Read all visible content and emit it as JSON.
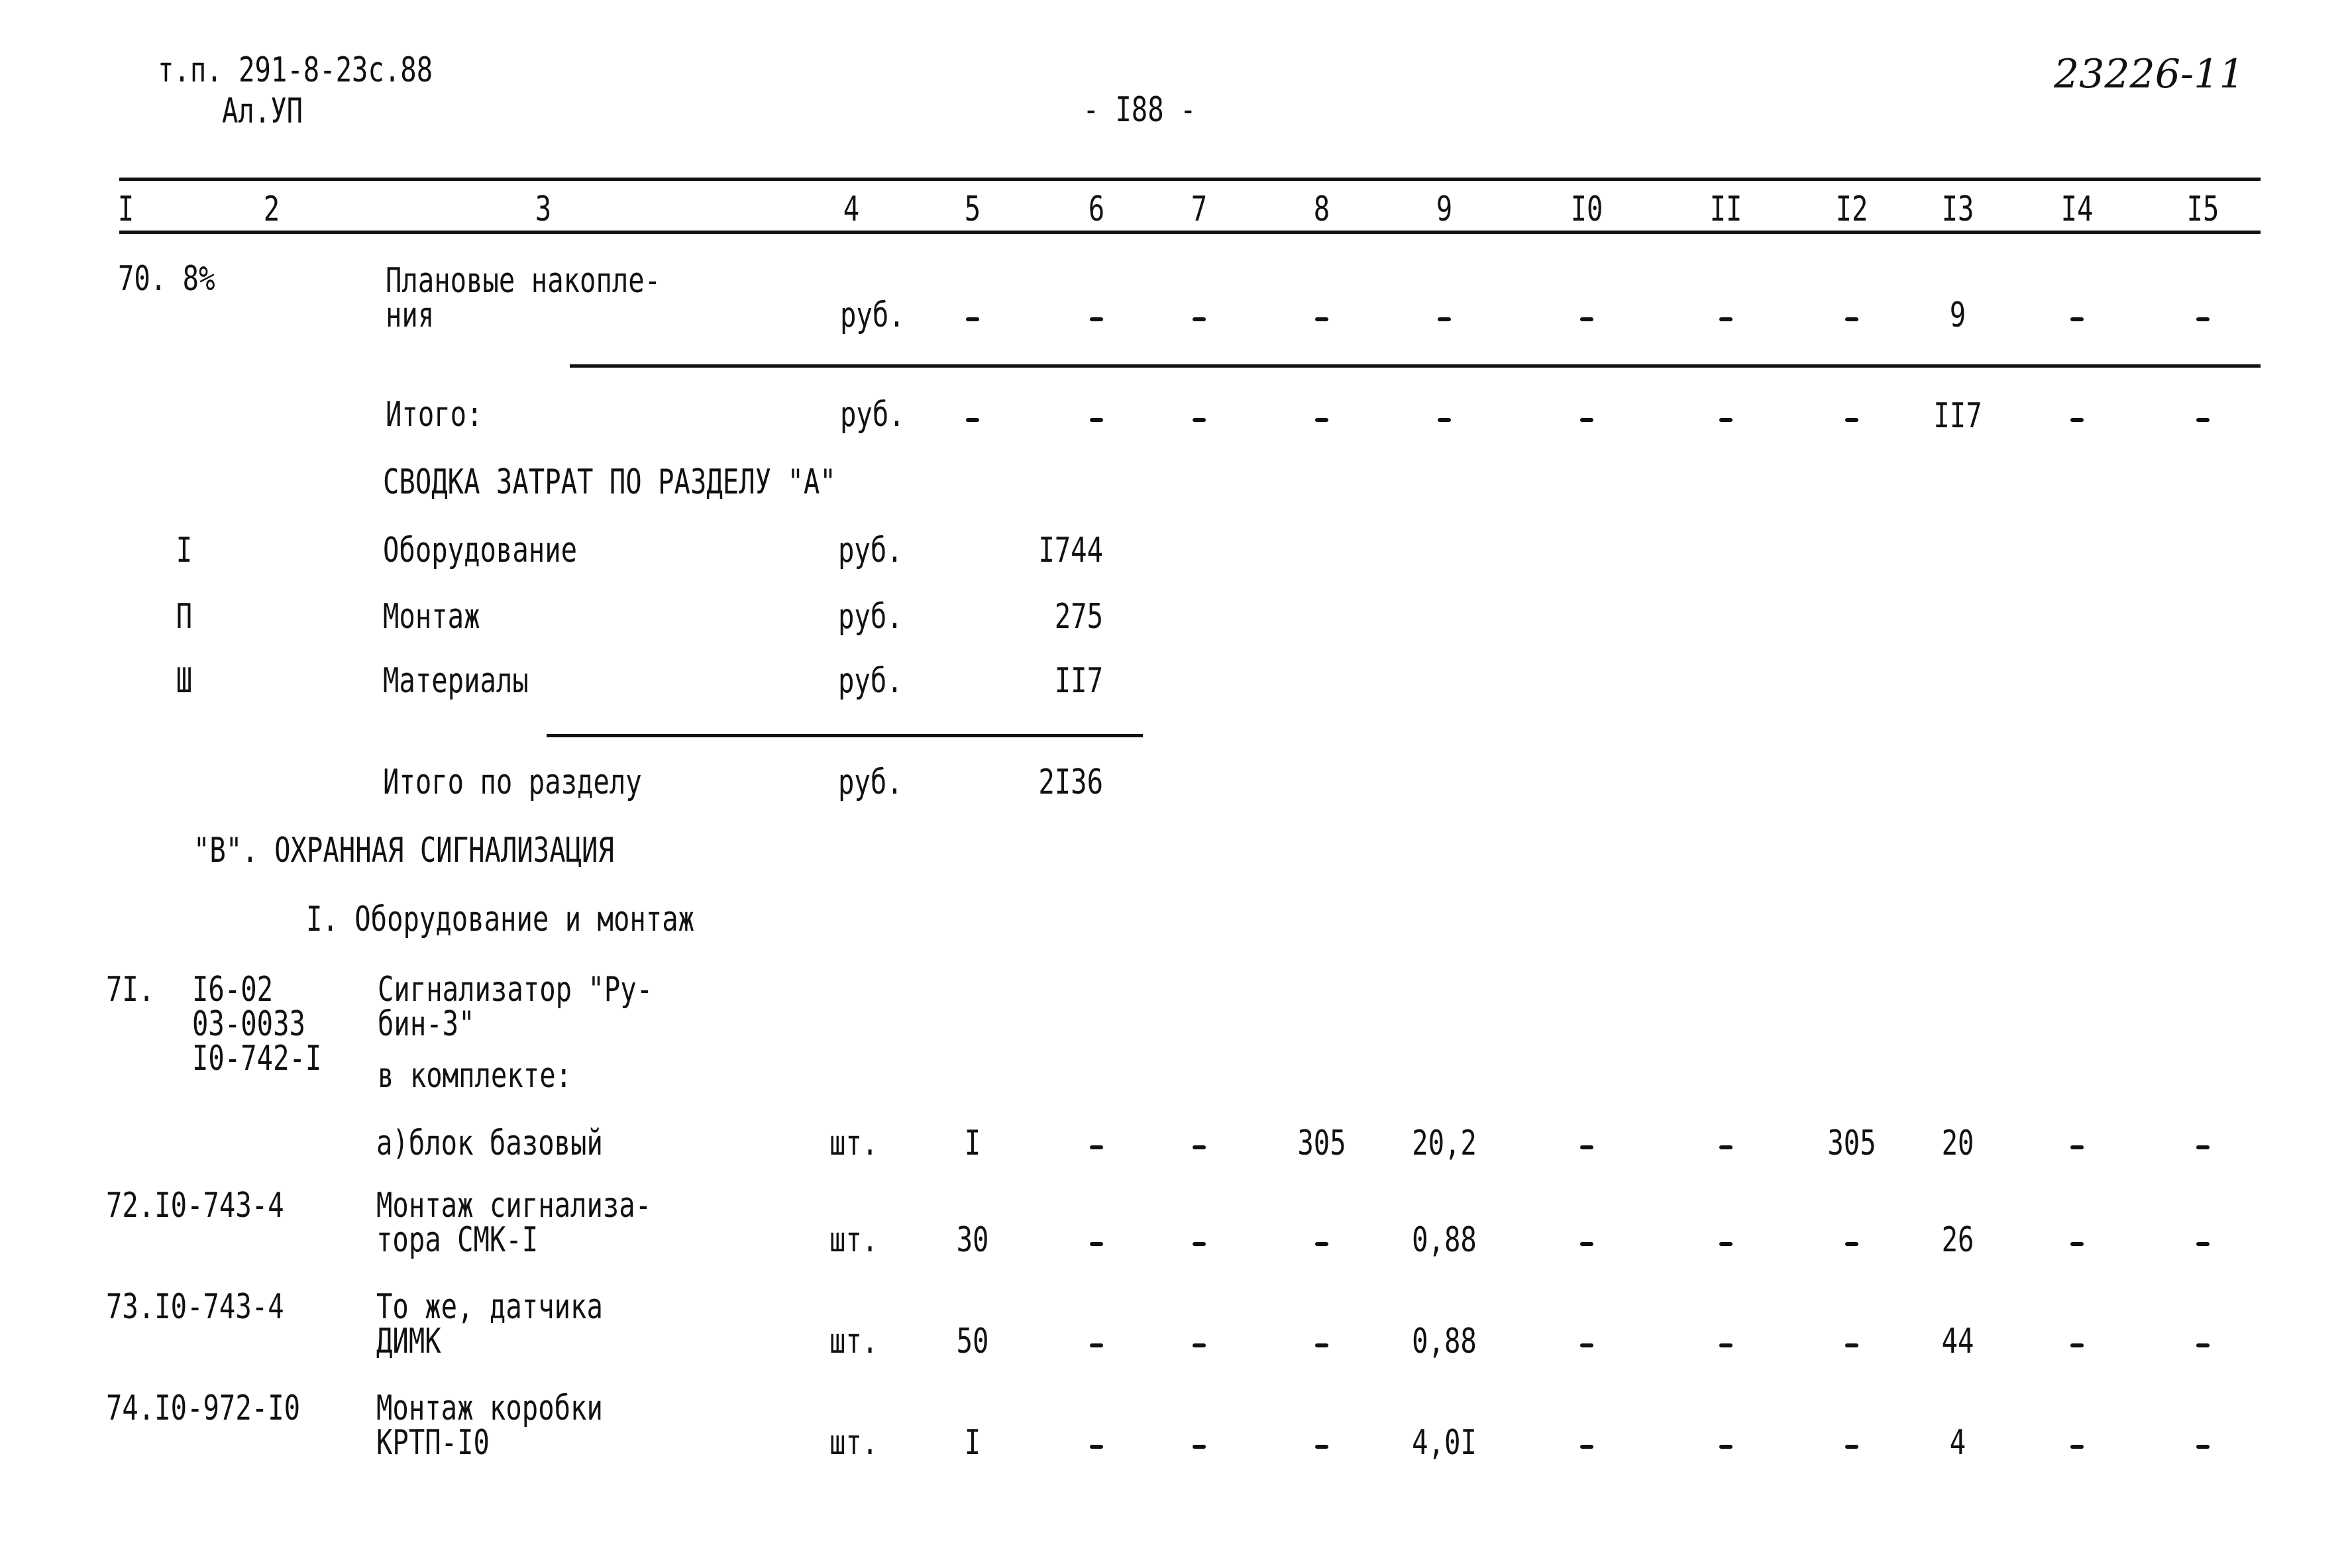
{
  "header": {
    "doc_ref": "т.п. 291-8-23с.88",
    "album": "Ал.УП",
    "page_number": "- I88 -",
    "inventory_number": "23226-11"
  },
  "columns": [
    "I",
    "2",
    "3",
    "4",
    "5",
    "6",
    "7",
    "8",
    "9",
    "I0",
    "II",
    "I2",
    "I3",
    "I4",
    "I5"
  ],
  "rows_top": [
    {
      "c1": "70. 8%",
      "c3a": "Плановые накопле-",
      "c3b": "ния",
      "c4": "руб.",
      "cells": [
        "-",
        "-",
        "-",
        "-",
        "-",
        "-",
        "-",
        "-",
        "9",
        "-",
        "-"
      ]
    },
    {
      "c3b": "Итого:",
      "c4": "руб.",
      "cells": [
        "-",
        "-",
        "-",
        "-",
        "-",
        "-",
        "-",
        "-",
        "II7",
        "-",
        "-"
      ]
    }
  ],
  "summary": {
    "title": "СВОДКА ЗАТРАТ ПО РАЗДЕЛУ \"А\"",
    "items": [
      {
        "num": "I",
        "label": "Оборудование",
        "unit": "руб.",
        "value": "I744"
      },
      {
        "num": "П",
        "label": "Монтаж",
        "unit": "руб.",
        "value": "275"
      },
      {
        "num": "Ш",
        "label": "Материалы",
        "unit": "руб.",
        "value": "II7"
      }
    ],
    "total": {
      "label": "Итого по разделу",
      "unit": "руб.",
      "value": "2I36"
    }
  },
  "section_b": {
    "title": "\"В\". ОХРАННАЯ СИГНАЛИЗАЦИЯ",
    "subtitle": "I. Оборудование и монтаж"
  },
  "item71": {
    "num": "7I.",
    "code1": "I6-02",
    "code2": "03-0033",
    "code3": "I0-742-I",
    "name1": "Сигнализатор \"Ру-",
    "name2": "бин-3\"",
    "name3": "в комплекте:"
  },
  "rows_bottom": [
    {
      "label1": "а)блок базовый",
      "label2": "",
      "code": "",
      "unit": "шт.",
      "qty": "I",
      "cells": [
        "-",
        "-",
        "305",
        "20,2",
        "-",
        "-",
        "305",
        "20",
        "-",
        "-"
      ]
    },
    {
      "code": "72.I0-743-4",
      "label1": "Монтаж сигнализа-",
      "label2": "тора СМК-I",
      "unit": "шт.",
      "qty": "30",
      "cells": [
        "-",
        "-",
        "-",
        "0,88",
        "-",
        "-",
        "-",
        "26",
        "-",
        "-"
      ]
    },
    {
      "code": "73.I0-743-4",
      "label1": "То же, датчика",
      "label2": "ДИМК",
      "unit": "шт.",
      "qty": "50",
      "cells": [
        "-",
        "-",
        "-",
        "0,88",
        "-",
        "-",
        "-",
        "44",
        "-",
        "-"
      ]
    },
    {
      "code": "74.I0-972-I0",
      "label1": "Монтаж коробки",
      "label2": "КРТП-I0",
      "unit": "шт.",
      "qty": "I",
      "cells": [
        "-",
        "-",
        "-",
        "4,0I",
        "-",
        "-",
        "-",
        "4",
        "-",
        "-"
      ]
    }
  ]
}
